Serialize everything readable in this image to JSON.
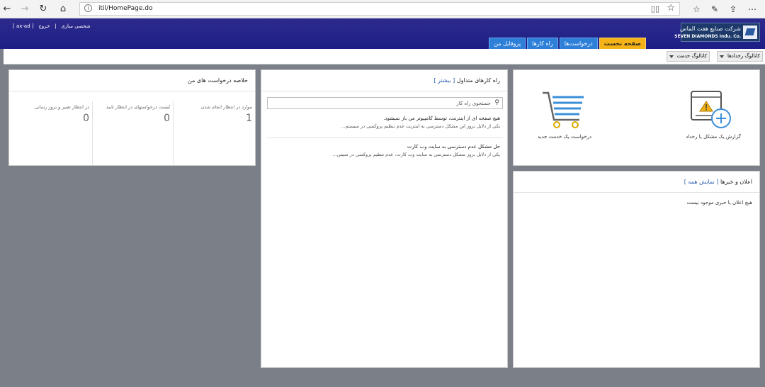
{
  "browser": {
    "url": "itil/HomePage.do"
  },
  "header": {
    "user_badge": "[ ax-ad ]",
    "logout": "خروج",
    "separator": "|",
    "personalize": "شخصی سازی",
    "logo_fa": "شرکت صنایع هفت الماس",
    "logo_en": "SEVEN DIAMONDS Indu. Co.",
    "tabs": [
      "صفحه نخست",
      "درخواست‌ها",
      "راه کارها",
      "پروفایل من"
    ]
  },
  "toolbar": {
    "incident_catalog": "کاتالوگ رخدادها",
    "service_catalog": "کاتالوگ خدمت"
  },
  "summary": {
    "title": "خلاصه درخواست های من",
    "stats": [
      {
        "label": "موارد در انتظار انجام شدن",
        "value": "1"
      },
      {
        "label": "لیست درخواستهای در انتظار تایید",
        "value": "0"
      },
      {
        "label": "در انتظار تغییر و بروز رسانی",
        "value": "0"
      }
    ]
  },
  "solutions": {
    "title": "راه کارهای متداول",
    "more": "[ بیشتر ]",
    "search_placeholder": "جستجوی راه کار",
    "items": [
      {
        "title": "هیچ صفحه ای از اینترنت، توسط کامپیوتر من باز نمیشود.",
        "desc": "یکی از دلایل بروز این مشکل دسترسی به اینترنت عدم تنظیم پروکسی در سیستم..."
      },
      {
        "title": "حل مشکل عدم دسترسی به سایت وب کارت",
        "desc": "یکی از دلایل بروز مشکل دسترسی به سایت وب کارت، عدم تنظیم پروکسی در سیس..."
      }
    ]
  },
  "actions": {
    "report_incident": "گزارش یک مشکل یا رخداد",
    "new_service": "درخواست یک خدمت جدید"
  },
  "news": {
    "title": "اعلان و خبرها",
    "show_all": "[ نمایش همه ]",
    "empty": "هیچ اعلان یا خبری موجود نیست"
  }
}
